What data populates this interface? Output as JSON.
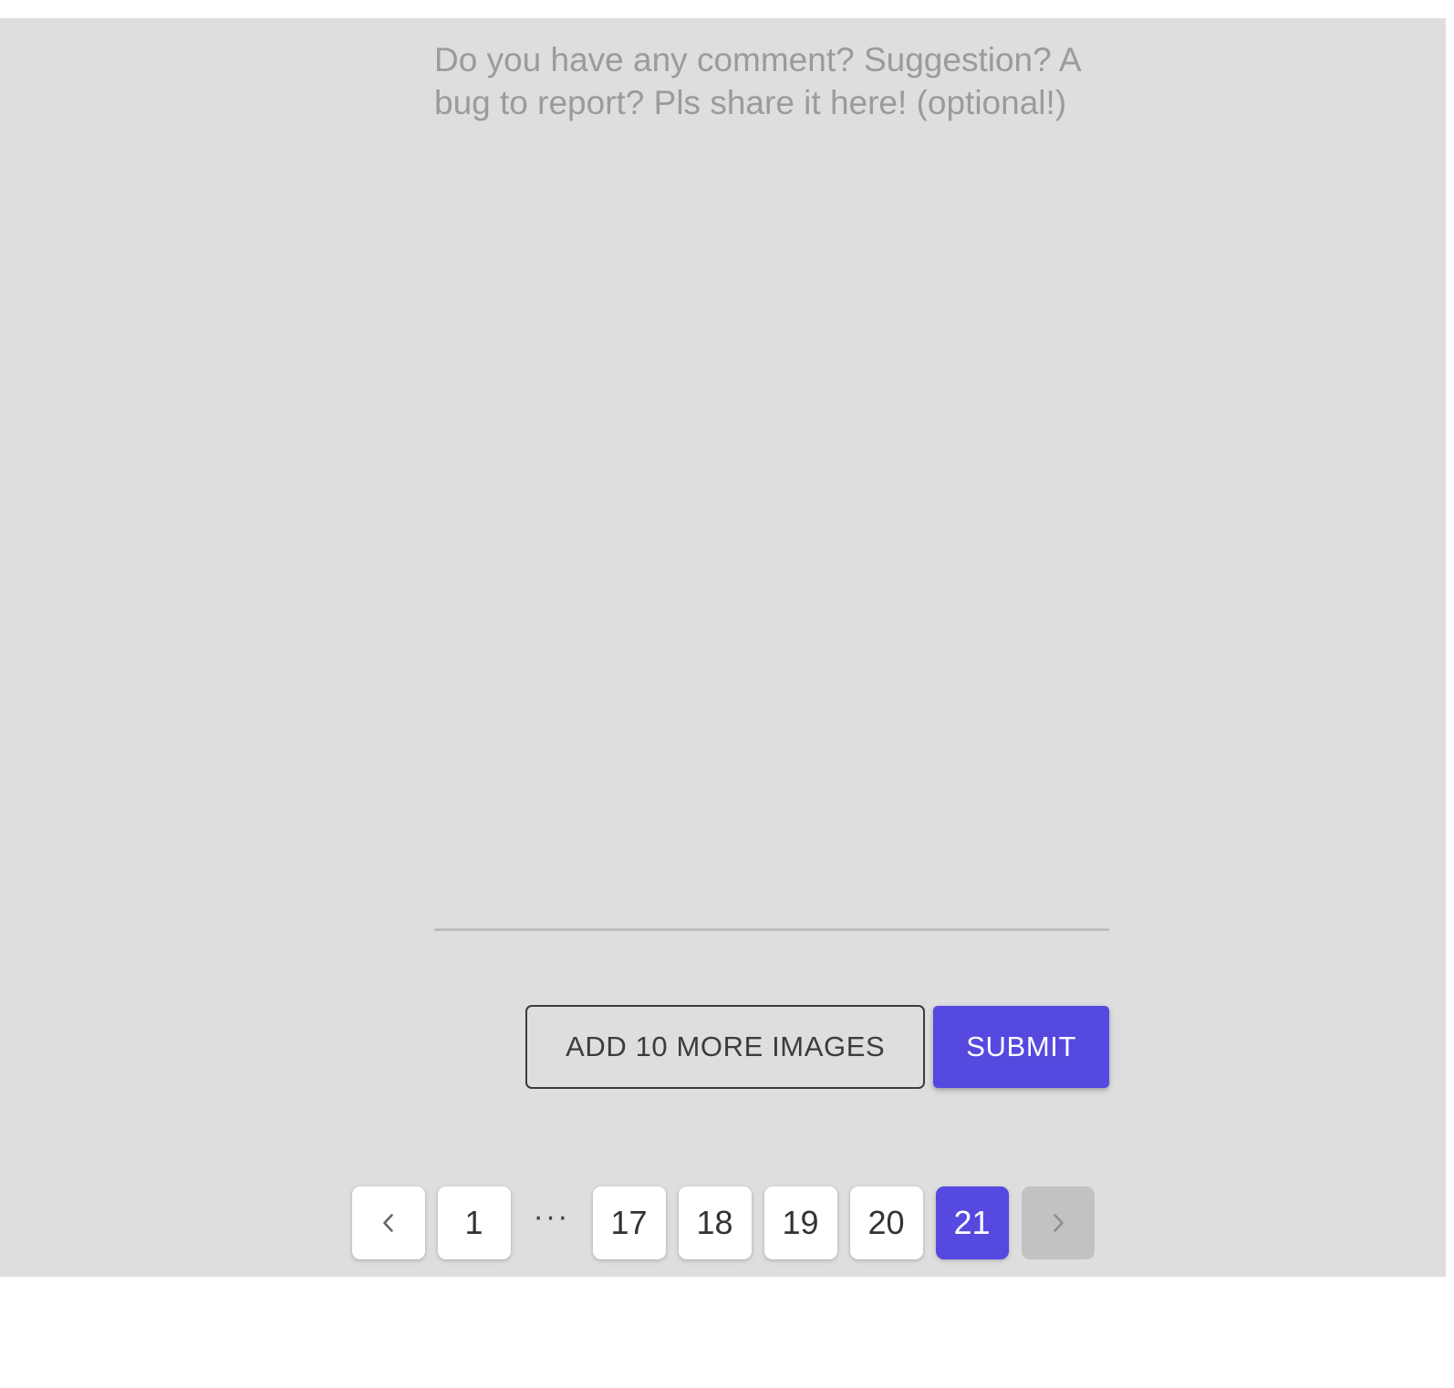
{
  "feedback_form": {
    "comment_field": {
      "placeholder": "Do you have any comment? Suggestion? A bug to report? Pls share it here! (optional!)",
      "value": ""
    },
    "actions": {
      "add_images_label": "ADD 10 MORE IMAGES",
      "submit_label": "SUBMIT"
    }
  },
  "pagination": {
    "prev_icon": "chevron-left-icon",
    "next_icon": "chevron-right-icon",
    "prev_disabled": false,
    "next_disabled": true,
    "ellipsis": "···",
    "current_page": "21",
    "pages": [
      {
        "label": "1",
        "active": false
      },
      {
        "label": "17",
        "active": false
      },
      {
        "label": "18",
        "active": false
      },
      {
        "label": "19",
        "active": false
      },
      {
        "label": "20",
        "active": false
      },
      {
        "label": "21",
        "active": true
      }
    ]
  },
  "colors": {
    "accent": "#5549e0",
    "surface": "#dedede",
    "page_button_bg": "#ffffff",
    "disabled_bg": "#c2c2c2",
    "divider": "#bdbdbd",
    "placeholder_text": "#9b9b9b",
    "outline_border": "#3c3c3c"
  }
}
